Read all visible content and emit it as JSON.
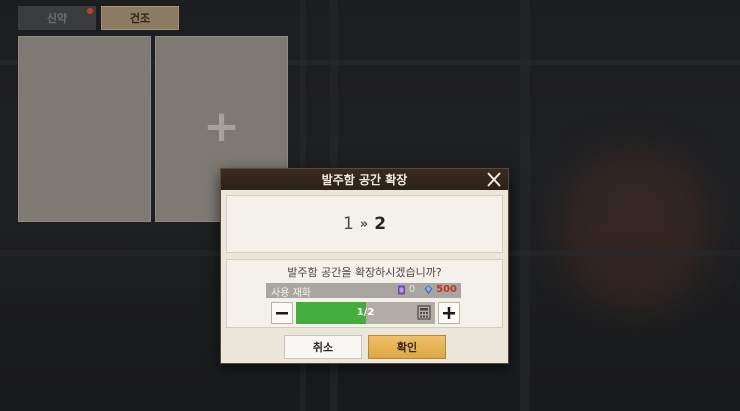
{
  "tabs": [
    {
      "label": "신약",
      "active": false,
      "has_notification": true
    },
    {
      "label": "건조",
      "active": true,
      "has_notification": false
    }
  ],
  "slots": [
    {
      "state": "empty"
    },
    {
      "state": "add",
      "icon": "plus-icon"
    }
  ],
  "dialog": {
    "title": "발주함 공간 확장",
    "level_from": "1",
    "level_to": "2",
    "question": "발주함 공간을 확장하시겠습니까?",
    "cost_label": "사용 재화",
    "owned_amount": "0",
    "price": "500",
    "quantity_text": "1/2",
    "quantity_fraction": 0.5,
    "cancel_label": "취소",
    "confirm_label": "확인"
  },
  "colors": {
    "accent_green": "#43ad3e",
    "confirm_gold": "#dca745",
    "price_red": "#c5322c"
  }
}
